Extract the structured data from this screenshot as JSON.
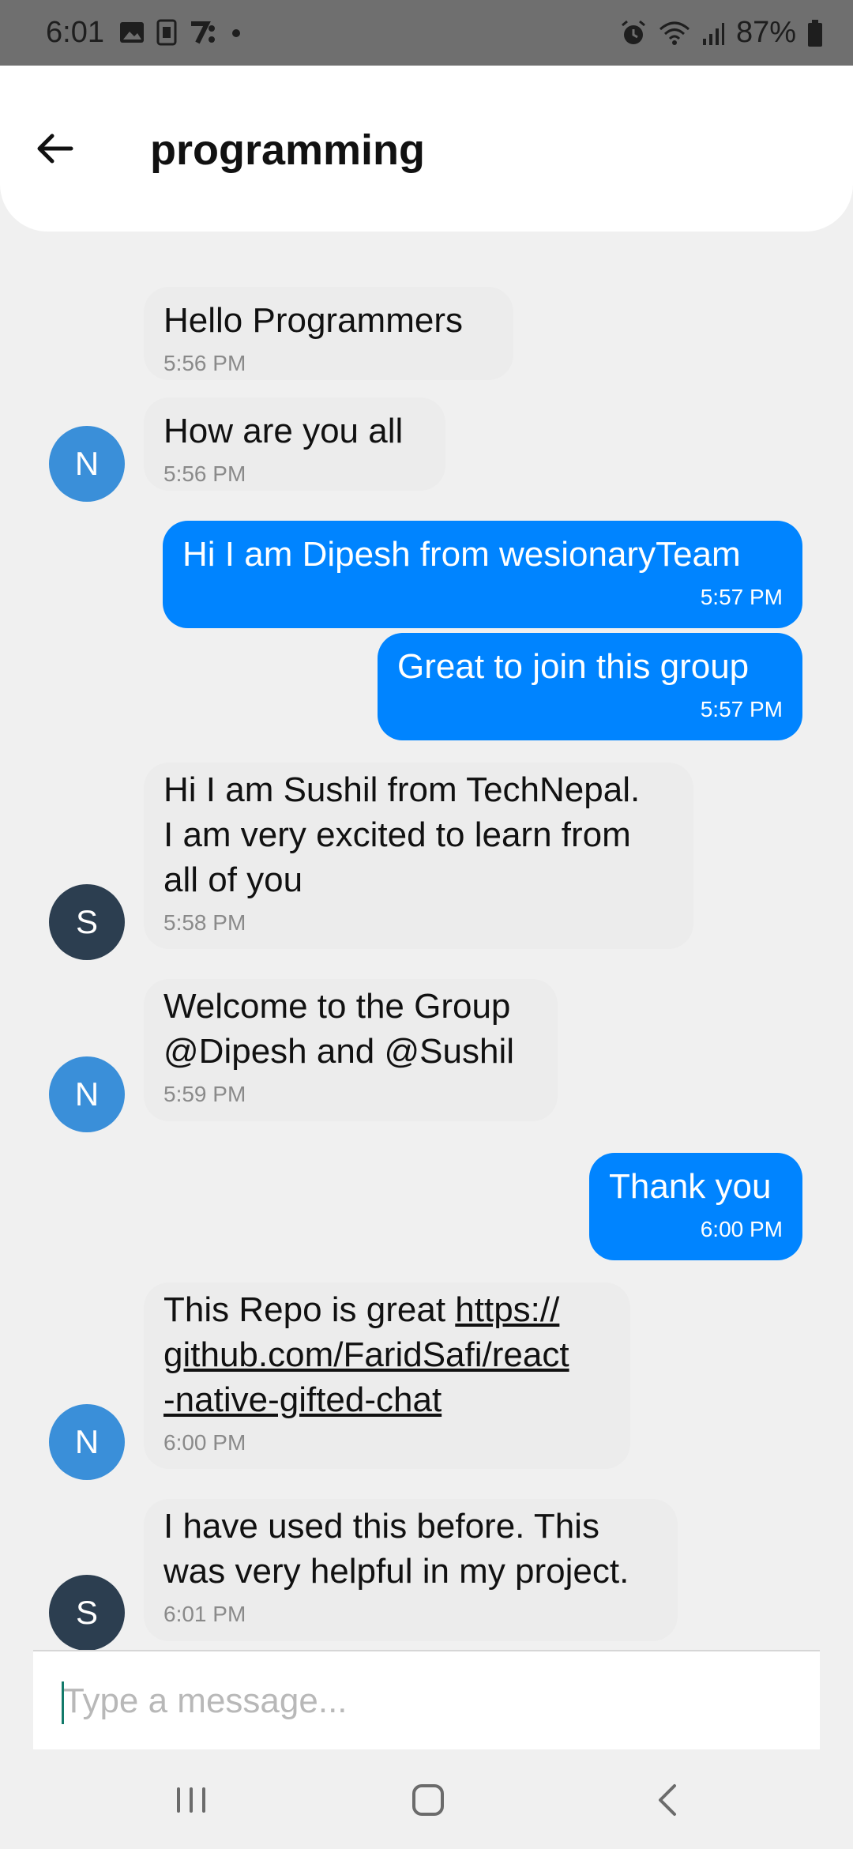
{
  "status_bar": {
    "time": "6:01",
    "battery": "87%",
    "left_icons": [
      "image-icon",
      "sim-icon",
      "app-logo-icon",
      "dot-icon"
    ],
    "right_icons": [
      "alarm-icon",
      "wifi-icon",
      "signal-icon",
      "battery-icon"
    ]
  },
  "header": {
    "title": "programming",
    "back_icon": "arrow-left-icon"
  },
  "messages": [
    {
      "side": "left",
      "avatar": "",
      "text": "Hello Programmers",
      "time": "5:56 PM"
    },
    {
      "side": "left",
      "avatar": "N",
      "text": "How are you all",
      "time": "5:56 PM"
    },
    {
      "side": "right",
      "text": "Hi I am Dipesh from wesionaryTeam",
      "time": "5:57 PM"
    },
    {
      "side": "right",
      "text": "Great to join this group",
      "time": "5:57 PM"
    },
    {
      "side": "left",
      "avatar": "S",
      "text_lines": [
        "Hi I am Sushil from TechNepal.",
        "I am very excited to learn from",
        "all of you"
      ],
      "time": "5:58 PM"
    },
    {
      "side": "left",
      "avatar": "N",
      "text_lines": [
        "Welcome to the Group",
        "@Dipesh and @Sushil"
      ],
      "time": "5:59 PM"
    },
    {
      "side": "right",
      "text": "Thank you",
      "time": "6:00 PM"
    },
    {
      "side": "left",
      "avatar": "N",
      "text_prefix": "This Repo is great ",
      "link_lines": [
        "https://",
        "github.com/FaridSafi/react",
        "-native-gifted-chat"
      ],
      "time": "6:00 PM"
    },
    {
      "side": "left",
      "avatar": "S",
      "text_lines": [
        "I have used this before. This",
        "was very helpful in my project."
      ],
      "time": "6:01 PM"
    }
  ],
  "composer": {
    "placeholder": "Type a message..."
  },
  "nav_bar": {
    "icons": [
      "recent-apps-icon",
      "home-icon",
      "back-nav-icon"
    ]
  },
  "colors": {
    "outgoing_bubble": "#0084ff",
    "incoming_bubble": "#ececec",
    "avatar_n": "#3a8fd9",
    "avatar_s": "#2c3e50"
  }
}
